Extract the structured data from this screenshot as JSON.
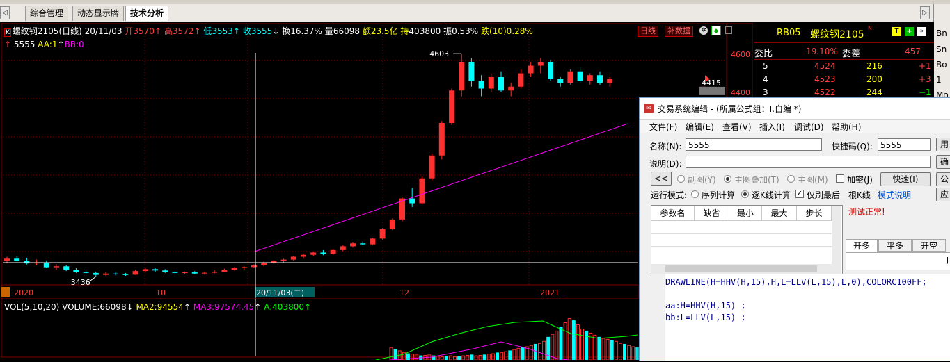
{
  "tabs": [
    {
      "label": "综合管理",
      "active": false
    },
    {
      "label": "动态显示牌",
      "active": false
    },
    {
      "label": "技术分析",
      "active": true
    }
  ],
  "nav": {
    "prev": "◁",
    "next": "▷"
  },
  "right_tools": [
    "Bn",
    "Sn",
    "Bo",
    "1",
    "Mo"
  ],
  "chart_info": {
    "k_badge": "K",
    "name": "螺纹钢2105",
    "period": "(日线)",
    "date": "20/11/03",
    "open_label": "开",
    "open": "3570",
    "open_arrow": "↑",
    "high_label": "高",
    "high": "3572",
    "high_arrow": "↑",
    "low_label": "低",
    "low": "3553",
    "low_arrow": "↑",
    "close_label": "收",
    "close": "3555",
    "close_arrow": "↓",
    "turnover": "换16.37%",
    "volume_label": "量",
    "volume": "66098",
    "amount_label": "额",
    "amount": "23.5亿",
    "hold_label": "持",
    "hold": "403800",
    "amplitude": "振0.53%",
    "change": "跌(10)0.28%",
    "line2_arrow": "↑",
    "line2_name": "5555",
    "line2_aa": "AA:1",
    "line2_aa_arrow": "↑",
    "line2_bb": "BB:0"
  },
  "chart_tags": {
    "period_btn": "日线",
    "supplement_btn": "补数据"
  },
  "chart_data": {
    "type": "candlestick",
    "symbol": "螺纹钢2105",
    "y_ticks": [
      "4600",
      "4400"
    ],
    "x_ticks": [
      "2020",
      "10",
      "11",
      "12",
      "2021"
    ],
    "crosshair_date": "20/11/03(二)",
    "high_label": "4603",
    "low_label": "3436",
    "last_label": "4415",
    "candles": [
      [
        3520,
        3540,
        3505,
        3530
      ],
      [
        3530,
        3545,
        3515,
        3520
      ],
      [
        3520,
        3535,
        3500,
        3505
      ],
      [
        3505,
        3525,
        3495,
        3510
      ],
      [
        3510,
        3520,
        3480,
        3485
      ],
      [
        3485,
        3500,
        3470,
        3490
      ],
      [
        3490,
        3495,
        3465,
        3470
      ],
      [
        3470,
        3480,
        3455,
        3460
      ],
      [
        3460,
        3470,
        3448,
        3455
      ],
      [
        3455,
        3462,
        3436,
        3445
      ],
      [
        3445,
        3458,
        3440,
        3452
      ],
      [
        3452,
        3460,
        3442,
        3448
      ],
      [
        3448,
        3455,
        3440,
        3446
      ],
      [
        3446,
        3470,
        3444,
        3465
      ],
      [
        3465,
        3480,
        3460,
        3475
      ],
      [
        3475,
        3480,
        3462,
        3468
      ],
      [
        3468,
        3475,
        3455,
        3460
      ],
      [
        3460,
        3466,
        3450,
        3455
      ],
      [
        3455,
        3462,
        3448,
        3458
      ],
      [
        3458,
        3465,
        3450,
        3452
      ],
      [
        3452,
        3460,
        3446,
        3456
      ],
      [
        3456,
        3468,
        3452,
        3462
      ],
      [
        3462,
        3478,
        3458,
        3472
      ],
      [
        3472,
        3485,
        3468,
        3480
      ],
      [
        3480,
        3490,
        3472,
        3486
      ],
      [
        3486,
        3500,
        3480,
        3495
      ],
      [
        3495,
        3515,
        3490,
        3510
      ],
      [
        3510,
        3525,
        3502,
        3518
      ],
      [
        3518,
        3530,
        3508,
        3525
      ],
      [
        3525,
        3545,
        3518,
        3540
      ],
      [
        3540,
        3555,
        3530,
        3550
      ],
      [
        3550,
        3568,
        3545,
        3562
      ],
      [
        3562,
        3575,
        3548,
        3555
      ],
      [
        3555,
        3580,
        3550,
        3575
      ],
      [
        3575,
        3600,
        3570,
        3595
      ],
      [
        3595,
        3615,
        3588,
        3610
      ],
      [
        3610,
        3620,
        3600,
        3605
      ],
      [
        3605,
        3640,
        3600,
        3635
      ],
      [
        3635,
        3690,
        3630,
        3685
      ],
      [
        3685,
        3740,
        3680,
        3735
      ],
      [
        3735,
        3850,
        3725,
        3845
      ],
      [
        3845,
        3900,
        3800,
        3820
      ],
      [
        3820,
        3960,
        3815,
        3950
      ],
      [
        3950,
        4080,
        3940,
        4070
      ],
      [
        4070,
        4250,
        4050,
        4240
      ],
      [
        4240,
        4420,
        4230,
        4410
      ],
      [
        4410,
        4603,
        4380,
        4560
      ],
      [
        4560,
        4580,
        4430,
        4460
      ],
      [
        4460,
        4490,
        4380,
        4420
      ],
      [
        4420,
        4500,
        4400,
        4480
      ],
      [
        4480,
        4510,
        4400,
        4410
      ],
      [
        4410,
        4450,
        4380,
        4430
      ],
      [
        4430,
        4520,
        4420,
        4500
      ],
      [
        4500,
        4560,
        4480,
        4540
      ],
      [
        4540,
        4580,
        4500,
        4560
      ],
      [
        4560,
        4570,
        4460,
        4470
      ],
      [
        4470,
        4480,
        4430,
        4450
      ],
      [
        4450,
        4520,
        4440,
        4510
      ],
      [
        4510,
        4530,
        4450,
        4460
      ],
      [
        4460,
        4500,
        4440,
        4490
      ],
      [
        4490,
        4510,
        4440,
        4450
      ],
      [
        4450,
        4480,
        4430,
        4470
      ]
    ]
  },
  "volume_panel": {
    "title": "VOL(5,10,20)",
    "volume_label": "VOLUME:66098",
    "volume_arrow": "↓",
    "ma2": "MA2:94554",
    "ma2_arrow": "↑",
    "ma3": "MA3:97574.45",
    "ma3_arrow": "↑",
    "a": "A:403800",
    "a_arrow": "↑",
    "bars": [
      30,
      25,
      22,
      18,
      15,
      14,
      12,
      10,
      11,
      12,
      10,
      9,
      8,
      9,
      10,
      8,
      9,
      10,
      11,
      12,
      10,
      11,
      12,
      14,
      15,
      17,
      18,
      20,
      22,
      25,
      28,
      30,
      32,
      35,
      38,
      40,
      45,
      55,
      62,
      70,
      80,
      90,
      100,
      95,
      85,
      75,
      70,
      65,
      60,
      55,
      52,
      50,
      48,
      45,
      40,
      38,
      35,
      32,
      30,
      28
    ]
  },
  "orderbook": {
    "code": "RB05",
    "name": "螺纹钢2105",
    "n_badge": "N",
    "t_badge": "T",
    "weibi_label": "委比",
    "weibi": "19.10%",
    "weicha_label": "委差",
    "weicha": "457",
    "rows": [
      {
        "level": "5",
        "price": "4524",
        "vol": "216",
        "chg": "+1"
      },
      {
        "level": "4",
        "price": "4523",
        "vol": "200",
        "chg": "+3"
      },
      {
        "level": "3",
        "price": "4522",
        "vol": "244",
        "chg": "−1"
      }
    ]
  },
  "dialog": {
    "title": "交易系统编辑 - (所属公式组：I.自编 *)",
    "menus": [
      "文件(F)",
      "编辑(E)",
      "查看(V)",
      "插入(I)",
      "调试(D)",
      "帮助(H)"
    ],
    "name_label": "名称(N):",
    "name_value": "5555",
    "shortcut_label": "快捷码(Q):",
    "shortcut_value": "5555",
    "desc_label": "说明(D):",
    "desc_value": "",
    "back_btn": "<<",
    "radio_sub": "副图(Y)",
    "radio_main_overlay": "主图叠加(T)",
    "radio_main": "主图(M)",
    "check_encrypt": "加密(J)",
    "fast_btn": "快速(I)",
    "mode_label": "运行模式:",
    "mode_seq": "序列计算",
    "mode_kline": "逐K线计算",
    "check_last": "仅刷最后一根K线",
    "mode_help": "模式说明",
    "grid_headers": [
      "参数名",
      "缺省",
      "最小",
      "最大",
      "步长"
    ],
    "test_status": "测试正常!",
    "tabs": [
      "开多",
      "平多",
      "开空",
      "j"
    ],
    "side_btns": [
      "用",
      "确",
      "公",
      "应"
    ],
    "code": [
      "DRAWLINE(H=HHV(H,15),H,L=LLV(L,15),L,0),COLORC100FF;",
      "",
      "aa:H=HHV(H,15) ;",
      "bb:L=LLV(L,15) ;"
    ]
  },
  "colors": {
    "up": "#ff3030",
    "down": "#00ffff",
    "drawline": "#ff00ff",
    "bg": "#000000",
    "grid": "#800000"
  }
}
